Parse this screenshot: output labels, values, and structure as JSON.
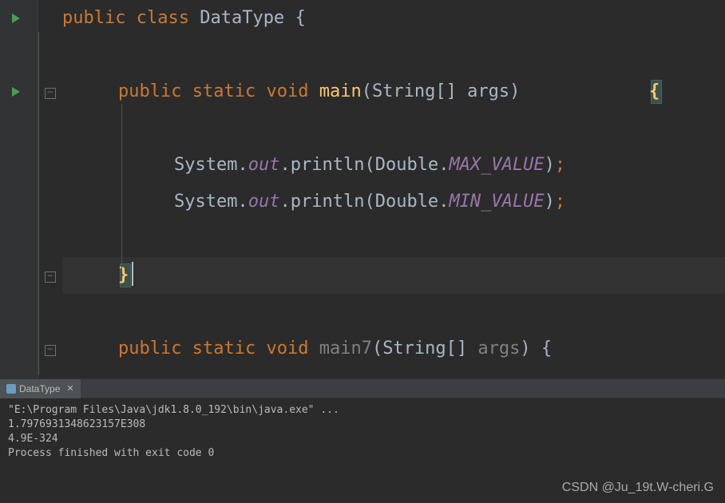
{
  "code": {
    "classDecl": {
      "kw1": "public",
      "kw2": "class",
      "name": "DataType",
      "brace": "{"
    },
    "mainDecl": {
      "kw1": "public",
      "kw2": "static",
      "kw3": "void",
      "name": "main",
      "lparen": "(",
      "ptype": "String[]",
      "pname": "args",
      "rparen": ")",
      "brace": "{"
    },
    "stmt1": {
      "sys": "System",
      "dot1": ".",
      "out": "out",
      "dot2": ".",
      "println": "println",
      "lparen": "(",
      "dbl": "Double",
      "dot3": ".",
      "const": "MAX_VALUE",
      "rparen": ")",
      "semi": ";"
    },
    "stmt2": {
      "sys": "System",
      "dot1": ".",
      "out": "out",
      "dot2": ".",
      "println": "println",
      "lparen": "(",
      "dbl": "Double",
      "dot3": ".",
      "const": "MIN_VALUE",
      "rparen": ")",
      "semi": ";"
    },
    "closeBrace": "}",
    "main7Decl": {
      "kw1": "public",
      "kw2": "static",
      "kw3": "void",
      "name": "main7",
      "lparen": "(",
      "ptype": "String[]",
      "pname": "args",
      "rparen": ")",
      "brace": "{"
    }
  },
  "console": {
    "tabName": "DataType",
    "lines": [
      "\"E:\\Program Files\\Java\\jdk1.8.0_192\\bin\\java.exe\" ...",
      "1.7976931348623157E308",
      "4.9E-324",
      "",
      "Process finished with exit code 0"
    ]
  },
  "watermark": "CSDN @Ju_19t.W-cheri.G"
}
